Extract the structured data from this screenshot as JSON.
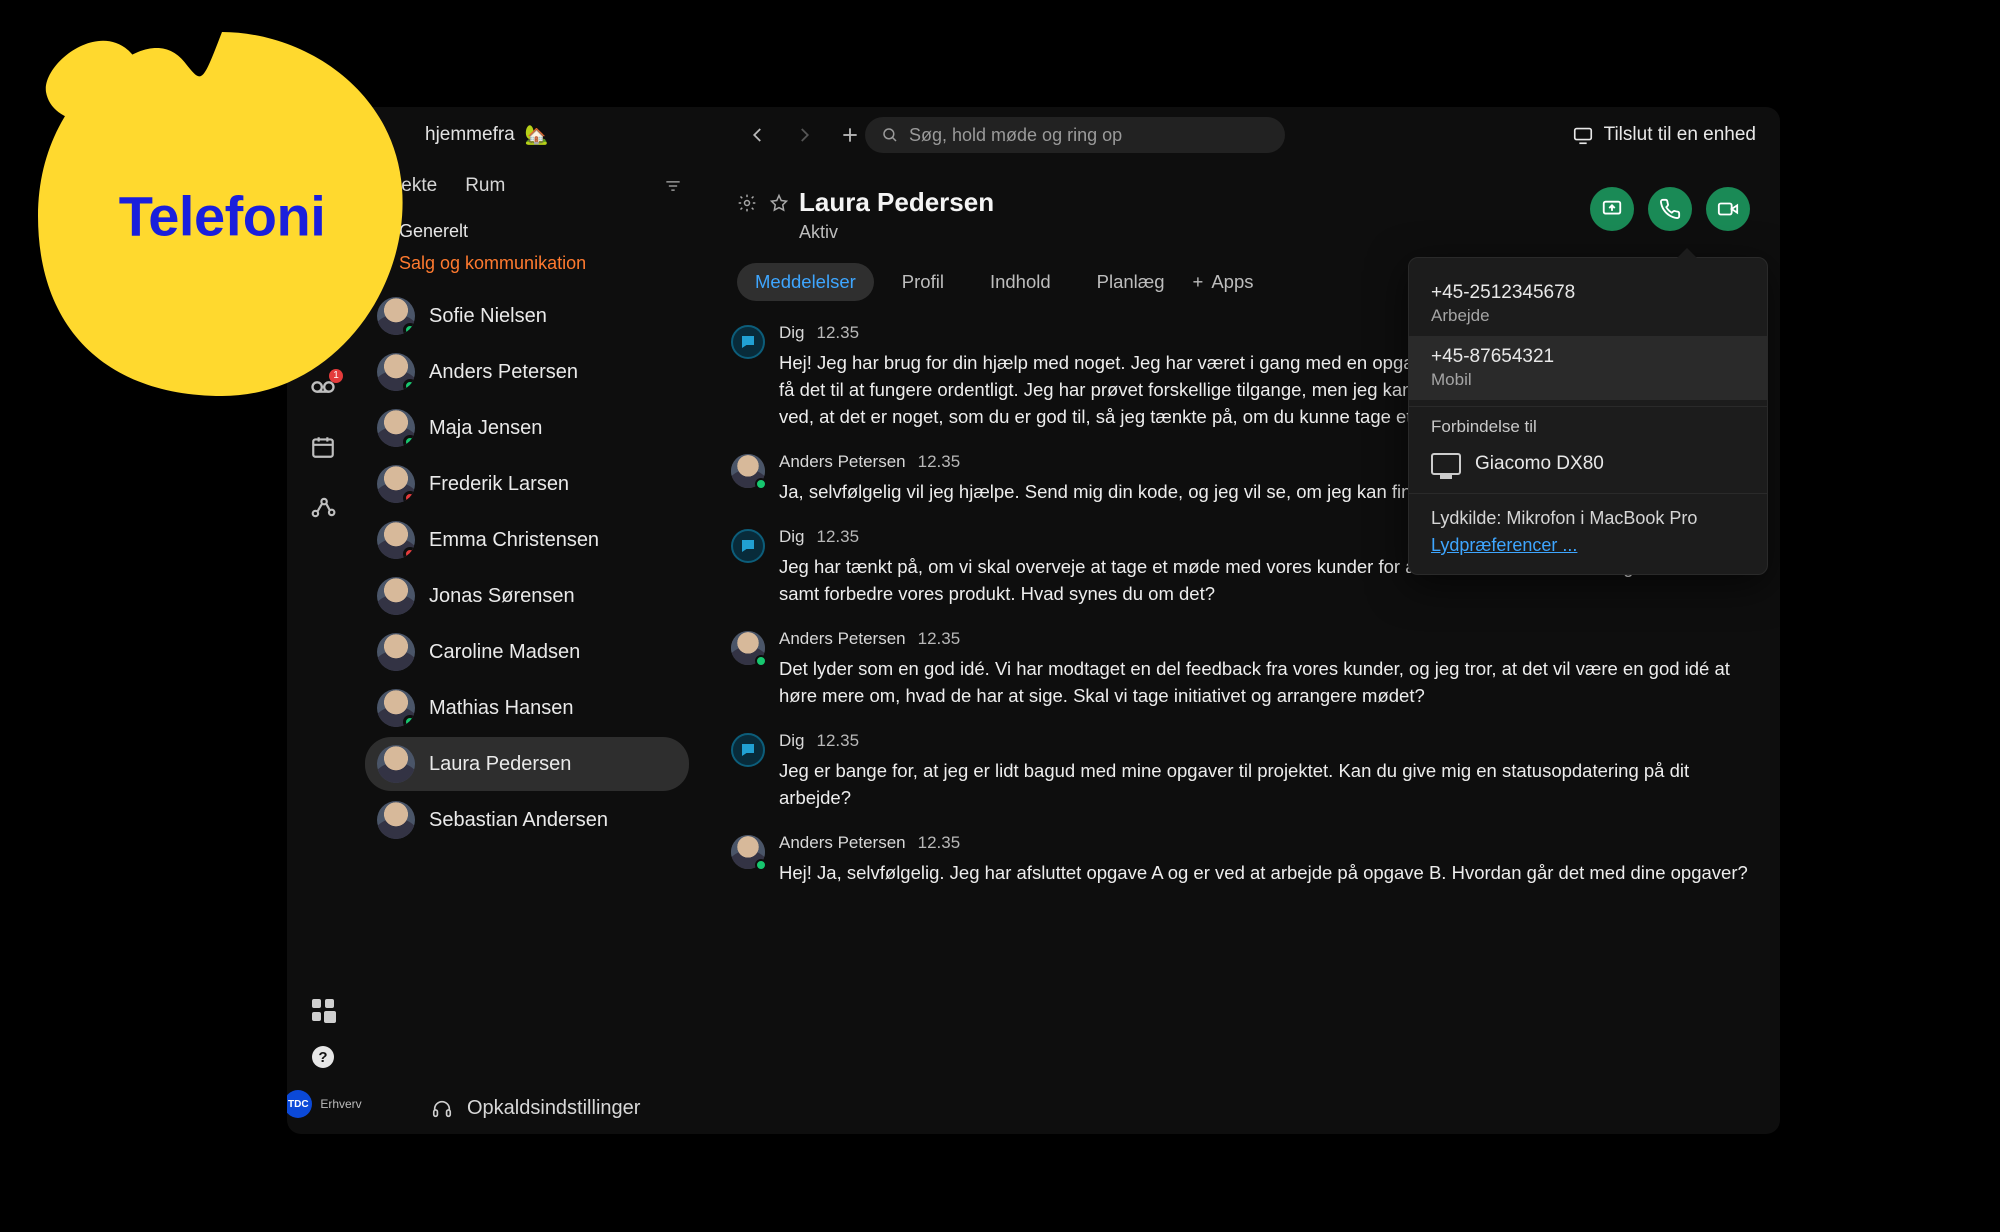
{
  "overlay": {
    "label": "Telefoni"
  },
  "topbar": {
    "status": "hjemmefra",
    "status_emoji": "🏡",
    "search_placeholder": "Søg, hold møde og ring op",
    "connect": "Tilslut til en enhed"
  },
  "nav": {
    "tabs": {
      "direct": "Direkte",
      "rooms": "Rum"
    },
    "spaces": {
      "general": "Generelt",
      "sales": "Salg og kommunikation"
    },
    "rail_badge": "1",
    "contacts": [
      {
        "name": "Sofie Nielsen",
        "presence": "active",
        "selected": false
      },
      {
        "name": "Anders Petersen",
        "presence": "active",
        "selected": false
      },
      {
        "name": "Maja Jensen",
        "presence": "active",
        "selected": false
      },
      {
        "name": "Frederik Larsen",
        "presence": "dnd",
        "selected": false
      },
      {
        "name": "Emma Christensen",
        "presence": "dnd",
        "selected": false
      },
      {
        "name": "Jonas Sørensen",
        "presence": "none",
        "selected": false
      },
      {
        "name": "Caroline Madsen",
        "presence": "none",
        "selected": false
      },
      {
        "name": "Mathias Hansen",
        "presence": "active",
        "selected": false
      },
      {
        "name": "Laura Pedersen",
        "presence": "none",
        "selected": true
      },
      {
        "name": "Sebastian Andersen",
        "presence": "none",
        "selected": false
      }
    ],
    "call_settings": "Opkaldsindstillinger",
    "brand_small": "Erhverv"
  },
  "header": {
    "title": "Laura Pedersen",
    "status": "Aktiv",
    "tabs": {
      "messages": "Meddelelser",
      "profile": "Profil",
      "content": "Indhold",
      "schedule": "Planlæg",
      "addapps": "Apps"
    }
  },
  "messages": [
    {
      "who": "Dig",
      "time": "12.35",
      "self": true,
      "text": "Hej! Jeg har brug for din hjælp med noget. Jeg har været i gang med en opgave i en uge, og jeg kan simpelthen ikke få det til at fungere ordentligt. Jeg har prøvet forskellige tilgange, men jeg kan simpelthen ikke få det til at fungere. Jeg ved, at det er noget, som du er god til, så jeg tænkte på, om du kunne tage et kig på det?"
    },
    {
      "who": "Anders Petersen",
      "time": "12.35",
      "self": false,
      "text": "Ja, selvfølgelig vil jeg hjælpe. Send mig din kode, og jeg vil se, om jeg kan finde ud af, hvad der er galt."
    },
    {
      "who": "Dig",
      "time": "12.35",
      "self": true,
      "text": "Jeg har tænkt på, om vi skal overveje at tage et møde med vores kunder for at diskutere deres behov og feedback samt forbedre vores produkt. Hvad synes du om det?"
    },
    {
      "who": "Anders Petersen",
      "time": "12.35",
      "self": false,
      "text": "Det lyder som en god idé. Vi har modtaget en del feedback fra vores kunder, og jeg tror, at det vil være en god idé at høre mere om, hvad de har at sige. Skal vi tage initiativet og arrangere mødet?"
    },
    {
      "who": "Dig",
      "time": "12.35",
      "self": true,
      "text": "Jeg er bange for, at jeg er lidt bagud med mine opgaver til projektet. Kan du give mig en statusopdatering på dit arbejde?"
    },
    {
      "who": "Anders Petersen",
      "time": "12.35",
      "self": false,
      "text": "Hej! Ja, selvfølgelig. Jeg har afsluttet opgave A og er ved at arbejde på opgave B. Hvordan går det med dine opgaver?"
    }
  ],
  "popover": {
    "numbers": [
      {
        "num": "+45-2512345678",
        "label": "Arbejde"
      },
      {
        "num": "+45-87654321",
        "label": "Mobil"
      }
    ],
    "connect_header": "Forbindelse til",
    "device": "Giacomo DX80",
    "audio_source": "Lydkilde: Mikrofon i MacBook Pro",
    "audio_link": "Lydpræferencer ..."
  }
}
